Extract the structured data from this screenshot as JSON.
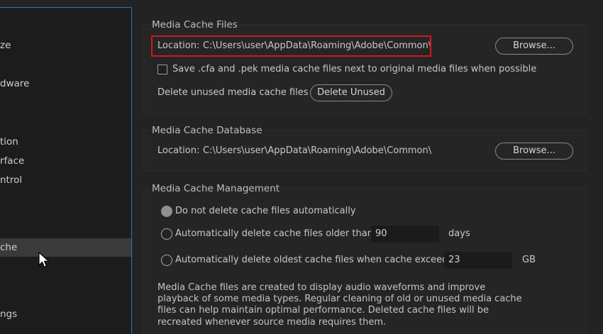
{
  "sidebar": {
    "items": [
      {
        "label": "ze",
        "selected": false
      },
      {
        "label": "dware",
        "selected": false
      },
      {
        "label": "tion",
        "selected": false
      },
      {
        "label": "rface",
        "selected": false
      },
      {
        "label": "ntrol",
        "selected": false
      },
      {
        "label": "che",
        "selected": true
      },
      {
        "label": "ngs",
        "selected": false
      }
    ]
  },
  "media_cache_files": {
    "title": "Media Cache Files",
    "location_label": "Location:",
    "location_path": "C:\\Users\\user\\AppData\\Roaming\\Adobe\\Common\\",
    "browse_label": "Browse...",
    "save_checkbox_label": "Save .cfa and .pek media cache files next to original media files when possible",
    "save_checked": false,
    "delete_label": "Delete unused media cache files",
    "delete_button_label": "Delete Unused"
  },
  "media_cache_database": {
    "title": "Media Cache Database",
    "location_label": "Location:",
    "location_path": "C:\\Users\\user\\AppData\\Roaming\\Adobe\\Common\\",
    "browse_label": "Browse..."
  },
  "media_cache_management": {
    "title": "Media Cache Management",
    "option_none_label": "Do not delete cache files automatically",
    "option_older_label": "Automatically delete cache files older than:",
    "older_value": "90",
    "older_unit": "days",
    "option_exceeds_label": "Automatically delete oldest cache files when cache exceeds:",
    "exceeds_value": "23",
    "exceeds_unit": "GB",
    "selected_option": "none",
    "info_text": "Media Cache files are created to display audio waveforms and improve playback of some media types.  Regular cleaning of old or unused media cache files can help maintain optimal performance. Deleted cache files will be recreated whenever source media requires them."
  },
  "colors": {
    "highlight": "#d0191f",
    "sidebar_border": "#2f6fd1"
  }
}
